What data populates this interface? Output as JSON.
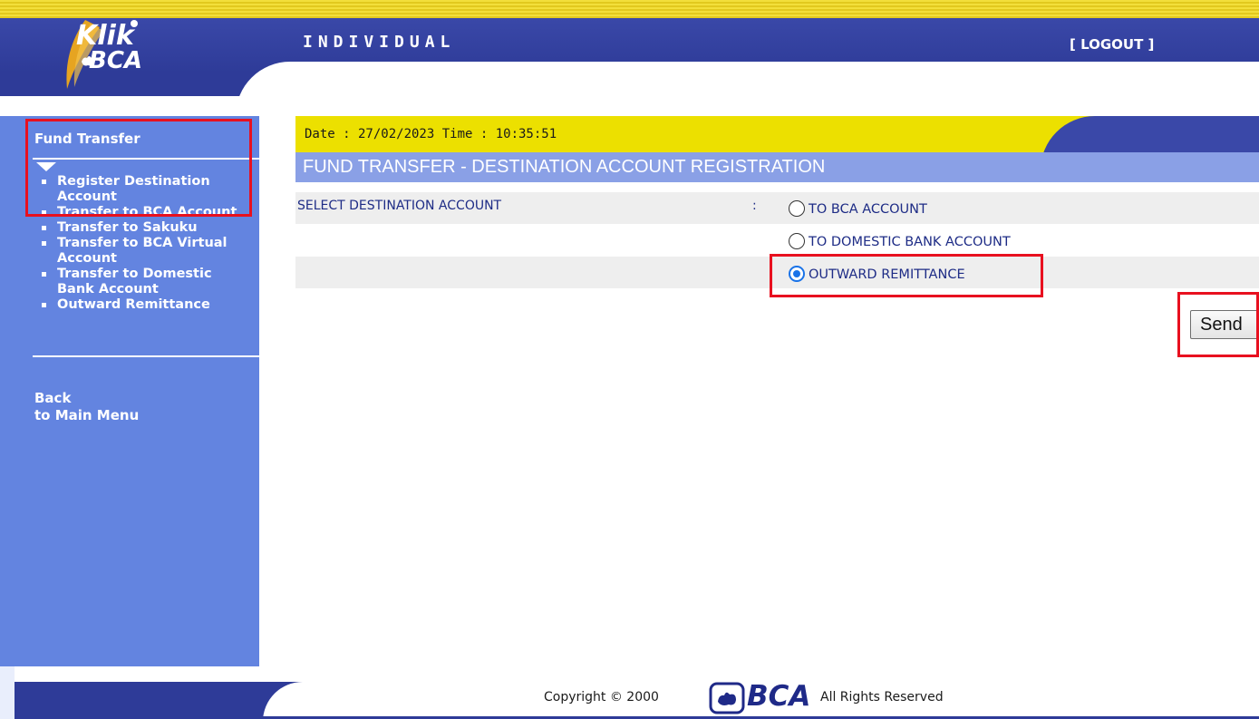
{
  "header": {
    "logo_line1": "Klik",
    "logo_line2": "BCA",
    "section_title": "INDIVIDUAL",
    "logout_label": "[ LOGOUT ]"
  },
  "sidebar": {
    "title": "Fund Transfer",
    "items": [
      {
        "label": "Register Destination",
        "label2": "Account",
        "highlighted": true
      },
      {
        "label": "Transfer to BCA Account"
      },
      {
        "label": "Transfer to Sakuku"
      },
      {
        "label": "Transfer to BCA Virtual",
        "label2": "Account"
      },
      {
        "label": "Transfer to Domestic",
        "label2": "Bank Account"
      },
      {
        "label": "Outward Remittance"
      }
    ],
    "back_line1": "Back",
    "back_line2": "to Main Menu"
  },
  "main": {
    "datetime": "Date : 27/02/2023 Time : 10:35:51",
    "page_title": "FUND TRANSFER - DESTINATION ACCOUNT REGISTRATION",
    "field_label": "SELECT DESTINATION ACCOUNT",
    "colon": ":",
    "options": [
      {
        "label": "TO BCA ACCOUNT",
        "checked": false
      },
      {
        "label": "TO DOMESTIC BANK ACCOUNT",
        "checked": false
      },
      {
        "label": "OUTWARD REMITTANCE",
        "checked": true
      }
    ],
    "send_label": "Send"
  },
  "footer": {
    "copyright": "Copyright © 2000",
    "brand": "BCA",
    "rights": "All Rights Reserved"
  },
  "colors": {
    "header_blue": "#2e3b98",
    "sidebar_blue": "#6384e0",
    "date_bar_yellow": "#ece000",
    "title_bar": "#8aa0e6",
    "highlight_red": "#e8101f",
    "text_navy": "#1e2c86"
  },
  "icons": {
    "logo": "bca-logo",
    "sidebar_marker": "triangle-down-icon",
    "bullet": "square-bullet-icon"
  }
}
